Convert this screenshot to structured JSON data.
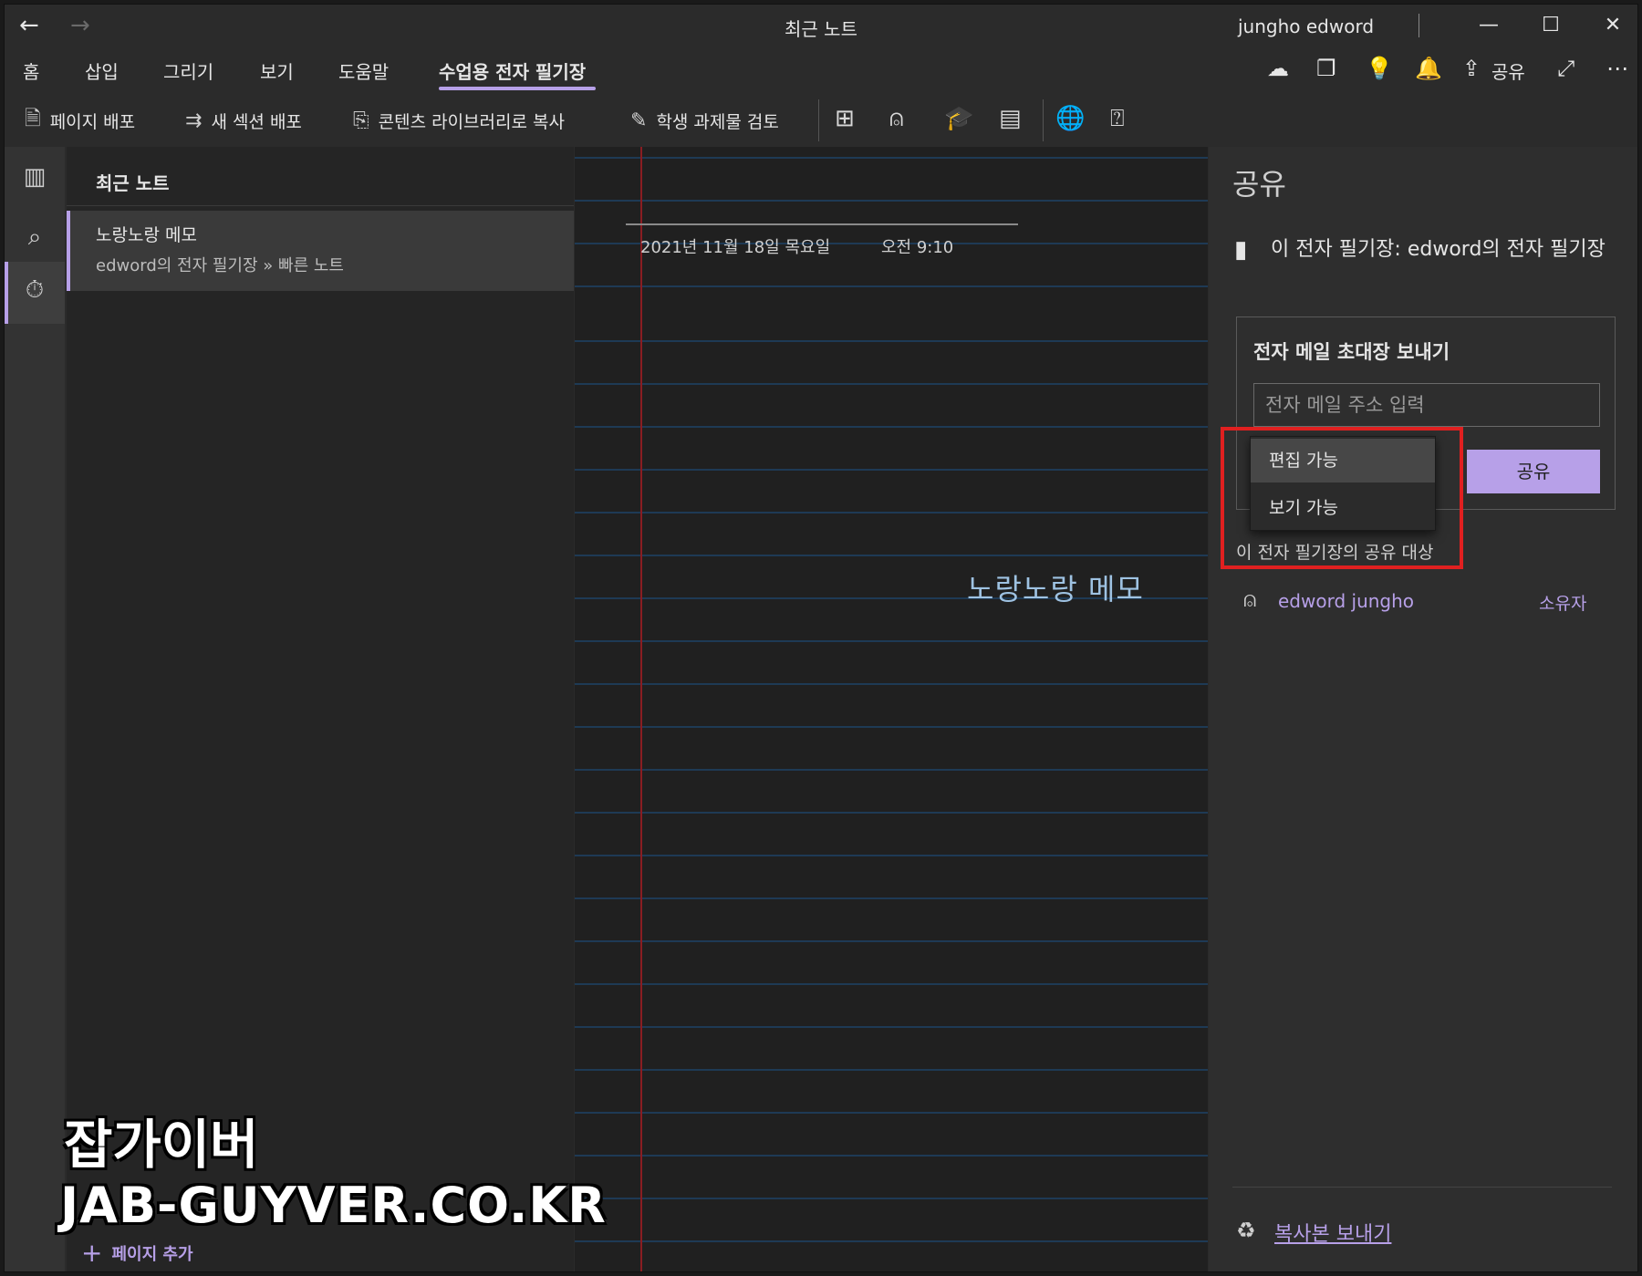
{
  "titlebar": {
    "title": "최근 노트",
    "user": "jungho edword",
    "back_icon": "←",
    "forward_icon": "→",
    "minimize": "—",
    "maximize": "☐",
    "close": "✕"
  },
  "tabs": {
    "items": [
      "홈",
      "삽입",
      "그리기",
      "보기",
      "도움말",
      "수업용 전자 필기장"
    ],
    "active_index": 5,
    "share_label": "공유"
  },
  "toolbar": {
    "distribute_page": "페이지 배포",
    "distribute_section": "새 섹션 배포",
    "copy_library": "콘텐츠 라이브러리로 복사",
    "review_assignments": "학생 과제물 검토"
  },
  "pagelist": {
    "title": "최근 노트",
    "item_title": "노랑노랑 메모",
    "item_subtitle": "edword의 전자 필기장 » 빠른 노트",
    "add_page": "페이지 추가"
  },
  "canvas": {
    "date": "2021년 11월 18일 목요일",
    "time": "오전 9:10",
    "memo": "노랑노랑 메모"
  },
  "share": {
    "title": "공유",
    "notebook_label": "이 전자 필기장: edword의 전자 필기장",
    "invite_title": "전자 메일 초대장 보내기",
    "email_placeholder": "전자 메일 주소 입력",
    "share_button": "공유",
    "shared_with_title": "이 전자 필기장의 공유 대상",
    "user_name": "edword jungho",
    "user_role": "소유자",
    "send_copy": "복사본 보내기"
  },
  "permission_dropdown": {
    "selected": "편집 가능",
    "options": [
      "편집 가능",
      "보기 가능"
    ]
  },
  "colors": {
    "accent": "#b7a0e8",
    "highlight": "#e02020",
    "rule_line": "#1e3a55",
    "margin_line": "#8a1d22"
  },
  "watermark": {
    "line1": "잡가이버",
    "line2": "JAB-GUYVER.CO.KR"
  }
}
